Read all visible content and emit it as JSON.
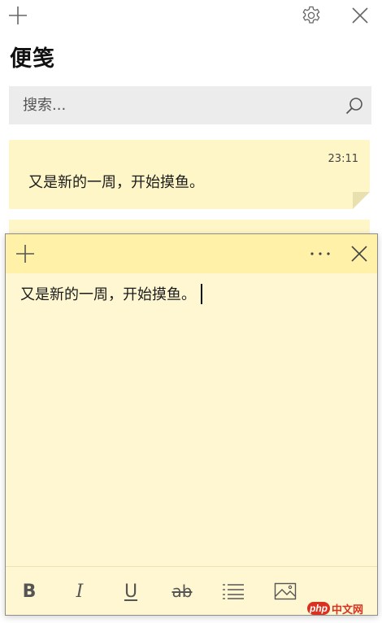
{
  "list_window": {
    "title": "便笺",
    "search": {
      "placeholder": "搜索...",
      "value": ""
    },
    "notes": [
      {
        "timestamp": "23:11",
        "preview": "又是新的一周，开始摸鱼。",
        "color": "#fff6c7"
      }
    ],
    "icons": {
      "add": "plus-icon",
      "settings": "gear-icon",
      "close": "close-icon",
      "search": "search-icon"
    }
  },
  "note_window": {
    "content": "又是新的一周，开始摸鱼。",
    "header_color": "#fff1a8",
    "body_color": "#fff7d1",
    "toolbar": {
      "bold_label": "B",
      "italic_label": "I",
      "underline_label": "U",
      "strike_label": "ab"
    },
    "icons": {
      "add": "plus-icon",
      "menu": "more-horizontal-icon",
      "close": "close-icon",
      "list": "bullet-list-icon",
      "image": "image-icon"
    }
  },
  "watermark": {
    "logo_text": "php",
    "site_text": "中文网"
  }
}
